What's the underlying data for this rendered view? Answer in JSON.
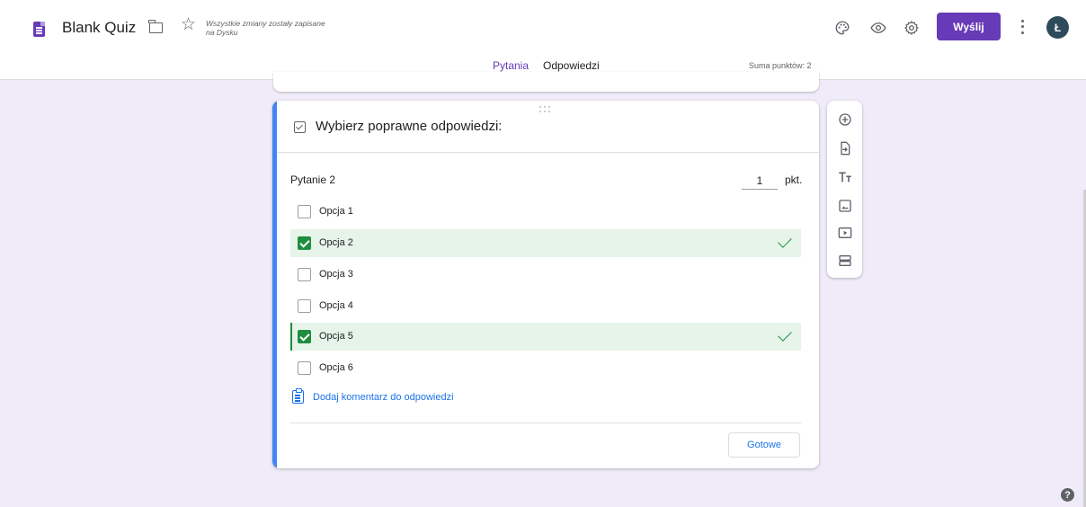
{
  "header": {
    "title": "Blank Quiz",
    "saved_status": "Wszystkie zmiany zostały zapisane na Dysku",
    "send_label": "Wyślij",
    "avatar_initial": "Ł",
    "icons": [
      "forms-doc-icon",
      "folder-icon",
      "star-icon",
      "palette-icon",
      "eye-icon",
      "gear-icon",
      "more-vert-icon"
    ]
  },
  "tabs": [
    {
      "label": "Pytania",
      "active": true
    },
    {
      "label": "Odpowiedzi",
      "active": false
    }
  ],
  "points_total": "Suma punktów: 2",
  "card": {
    "heading": "Wybierz poprawne odpowiedzi:",
    "question_title": "Pytanie 2",
    "points_value": "1",
    "points_label": "pkt.",
    "options": [
      {
        "label": "Opcja 1",
        "correct": false
      },
      {
        "label": "Opcja 2",
        "correct": true
      },
      {
        "label": "Opcja 3",
        "correct": false
      },
      {
        "label": "Opcja 4",
        "correct": false
      },
      {
        "label": "Opcja 5",
        "correct": true
      },
      {
        "label": "Opcja 6",
        "correct": false
      }
    ],
    "feedback_link": "Dodaj komentarz do odpowiedzi",
    "done_label": "Gotowe"
  },
  "toolbar": {
    "items": [
      "add-question-icon",
      "import-questions-icon",
      "add-title-icon",
      "add-image-icon",
      "add-video-icon",
      "add-section-icon"
    ]
  },
  "colors": {
    "brand": "#673ab7",
    "accent_blue": "#4285f4",
    "correct_green": "#1e8e3e",
    "correct_bg": "#e6f4ea",
    "page_bg": "#f0ebf8"
  }
}
